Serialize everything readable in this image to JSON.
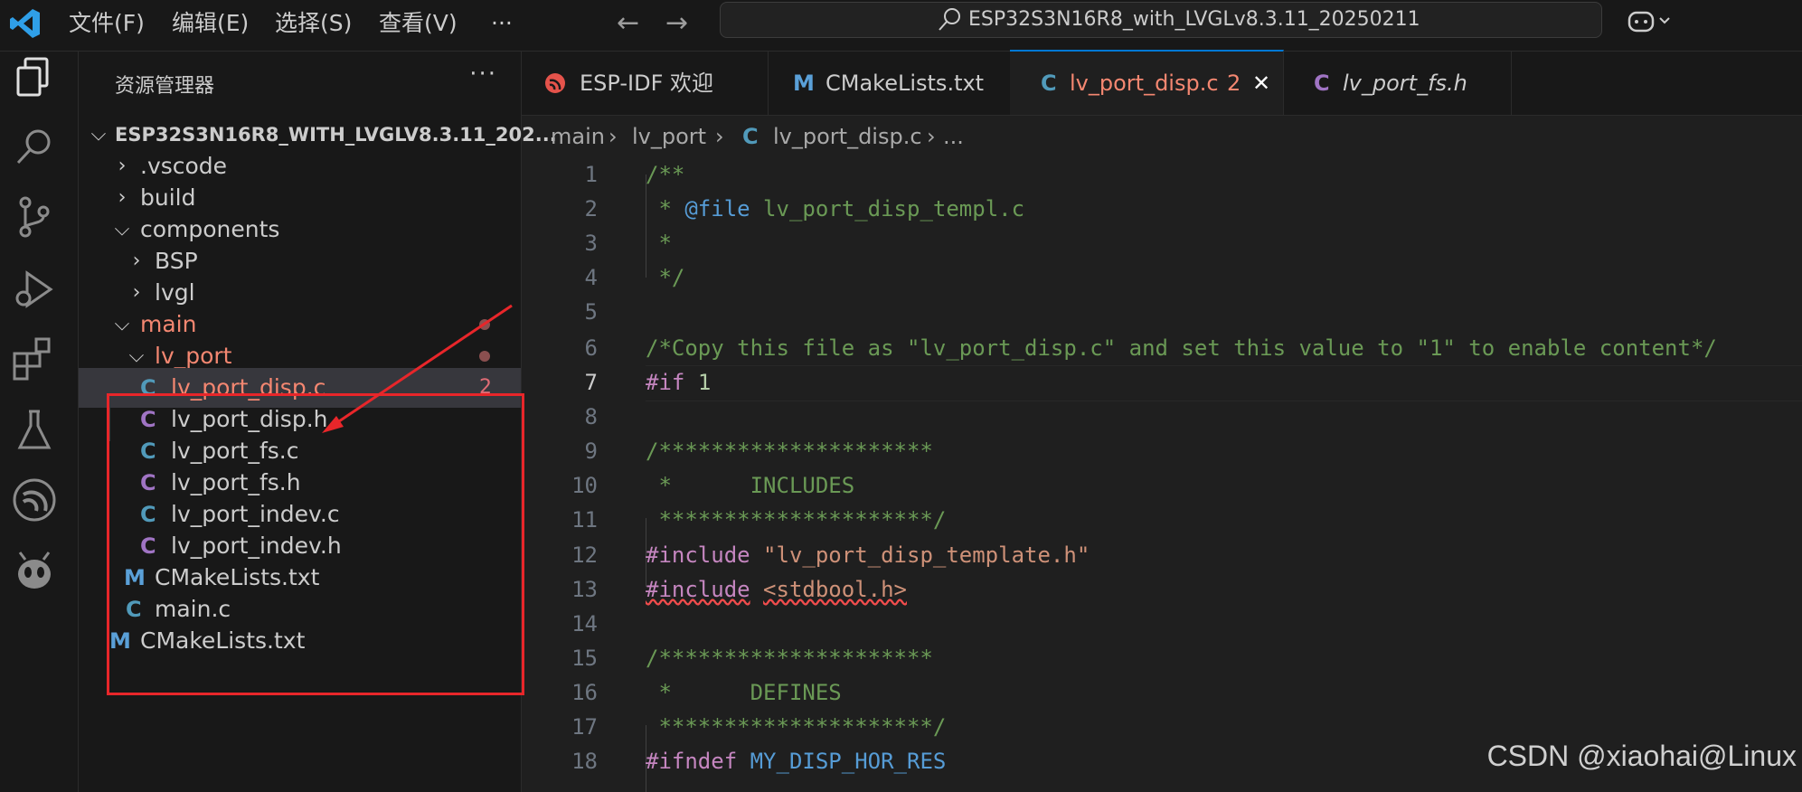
{
  "titlebar": {
    "menu": [
      "文件(F)",
      "编辑(E)",
      "选择(S)",
      "查看(V)",
      "···"
    ],
    "search_text": "ESP32S3N16R8_with_LVGLv8.3.11_20250211"
  },
  "sidebar": {
    "title": "资源管理器",
    "more": "···",
    "tree": [
      {
        "label": "ESP32S3N16R8_WITH_LVGLV8.3.11_202...",
        "kind": "root"
      },
      {
        "label": ".vscode",
        "kind": "folder"
      },
      {
        "label": "build",
        "kind": "folder"
      },
      {
        "label": "components",
        "kind": "folder-open"
      },
      {
        "label": "BSP",
        "kind": "folder"
      },
      {
        "label": "lvgl",
        "kind": "folder"
      },
      {
        "label": "main",
        "kind": "folder-open"
      },
      {
        "label": "lv_port",
        "kind": "folder-open"
      },
      {
        "label": "lv_port_disp.c",
        "kind": "c",
        "badge": "2"
      },
      {
        "label": "lv_port_disp.h",
        "kind": "h"
      },
      {
        "label": "lv_port_fs.c",
        "kind": "c"
      },
      {
        "label": "lv_port_fs.h",
        "kind": "h"
      },
      {
        "label": "lv_port_indev.c",
        "kind": "c"
      },
      {
        "label": "lv_port_indev.h",
        "kind": "h"
      },
      {
        "label": "CMakeLists.txt",
        "kind": "cmake"
      },
      {
        "label": "main.c",
        "kind": "c"
      },
      {
        "label": "CMakeLists.txt",
        "kind": "cmake"
      }
    ]
  },
  "tabs": [
    {
      "label": "ESP-IDF 欢迎",
      "icon": "esp-idf-icon"
    },
    {
      "label": "CMakeLists.txt",
      "icon": "cmake-icon"
    },
    {
      "label": "lv_port_disp.c",
      "icon": "c-file-icon",
      "badge": "2",
      "close": "✕"
    },
    {
      "label": "lv_port_fs.h",
      "icon": "h-file-icon"
    }
  ],
  "breadcrumb": [
    "main",
    "lv_port",
    "lv_port_disp.c",
    "..."
  ],
  "editor": {
    "line_numbers": [
      "1",
      "2",
      "3",
      "4",
      "5",
      "6",
      "7",
      "8",
      "9",
      "10",
      "11",
      "12",
      "13",
      "14",
      "15",
      "16",
      "17",
      "18"
    ],
    "lines": [
      "/**",
      " * @file lv_port_disp_templ.c",
      " *",
      " */",
      "",
      "/*Copy this file as \"lv_port_disp.c\" and set this value to \"1\" to enable content*/",
      "#if 1",
      "",
      "/*********************",
      " *      INCLUDES",
      " *********************/",
      "#include \"lv_port_disp_template.h\"",
      "#include <stdbool.h>",
      "",
      "/*********************",
      " *      DEFINES",
      " *********************/",
      "#ifndef MY_DISP_HOR_RES"
    ]
  },
  "watermark": "CSDN @xiaohai@Linux",
  "colors": {
    "accent": "#0078d4",
    "error": "#f14c4c",
    "annotation": "#e8262a"
  }
}
